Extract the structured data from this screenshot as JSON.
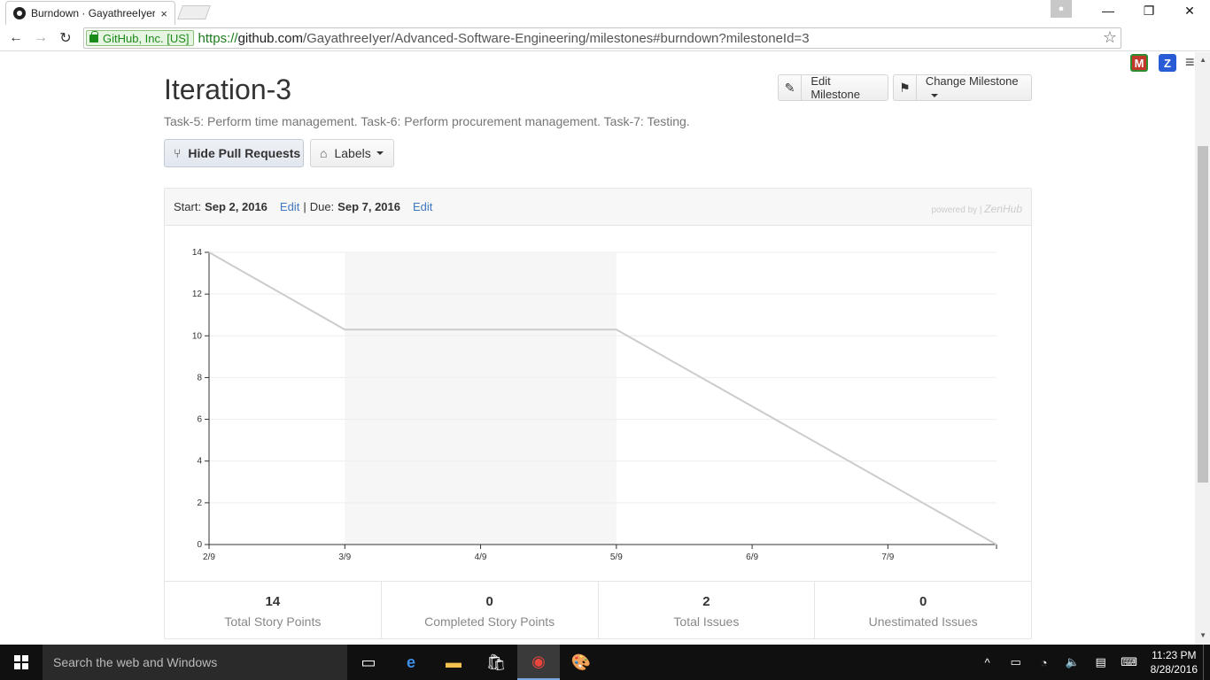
{
  "browser": {
    "tab_title": "Burndown · GayathreeIyer/A",
    "tab_close": "×",
    "secure_label": "GitHub, Inc. [US]",
    "url_scheme": "https://",
    "url_host": "github.com",
    "url_path": "/GayathreeIyer/Advanced-Software-Engineering/milestones#burndown?milestoneId=3",
    "ext1_label": "M",
    "ext2_label": "Z",
    "window_min": "—",
    "window_restore": "❐",
    "window_close": "✕"
  },
  "milestone": {
    "title": "Iteration-3",
    "description": "Task-5: Perform time management. Task-6: Perform procurement management. Task-7: Testing.",
    "edit_button": "Edit Milestone",
    "change_button": "Change Milestone",
    "hide_pr_button": "Hide Pull Requests",
    "labels_button": "Labels"
  },
  "panel": {
    "start_label": "Start:",
    "start_date": "Sep 2, 2016",
    "edit_start": "Edit",
    "sep": "|",
    "due_label": "Due:",
    "due_date": "Sep 7, 2016",
    "edit_due": "Edit",
    "powered_by": "powered by |",
    "powered_brand": "ZenHub"
  },
  "chart_data": {
    "type": "line",
    "x_ticks": [
      "2/9",
      "3/9",
      "4/9",
      "5/9",
      "6/9",
      "7/9"
    ],
    "y_ticks": [
      0,
      2,
      4,
      6,
      8,
      10,
      12,
      14
    ],
    "ylim": [
      0,
      14
    ],
    "xlim": [
      0,
      5.8
    ],
    "shaded_range": [
      1,
      3
    ],
    "series": [
      {
        "points": [
          [
            0,
            14
          ],
          [
            1,
            10.3
          ],
          [
            3,
            10.3
          ],
          [
            5.8,
            0
          ]
        ],
        "color": "#cccccc"
      }
    ],
    "grid": true
  },
  "stats": [
    {
      "value": "14",
      "label": "Total Story Points"
    },
    {
      "value": "0",
      "label": "Completed Story Points"
    },
    {
      "value": "2",
      "label": "Total Issues"
    },
    {
      "value": "0",
      "label": "Unestimated Issues"
    }
  ],
  "taskbar": {
    "search_placeholder": "Search the web and Windows",
    "time": "11:23 PM",
    "date": "8/28/2016"
  }
}
